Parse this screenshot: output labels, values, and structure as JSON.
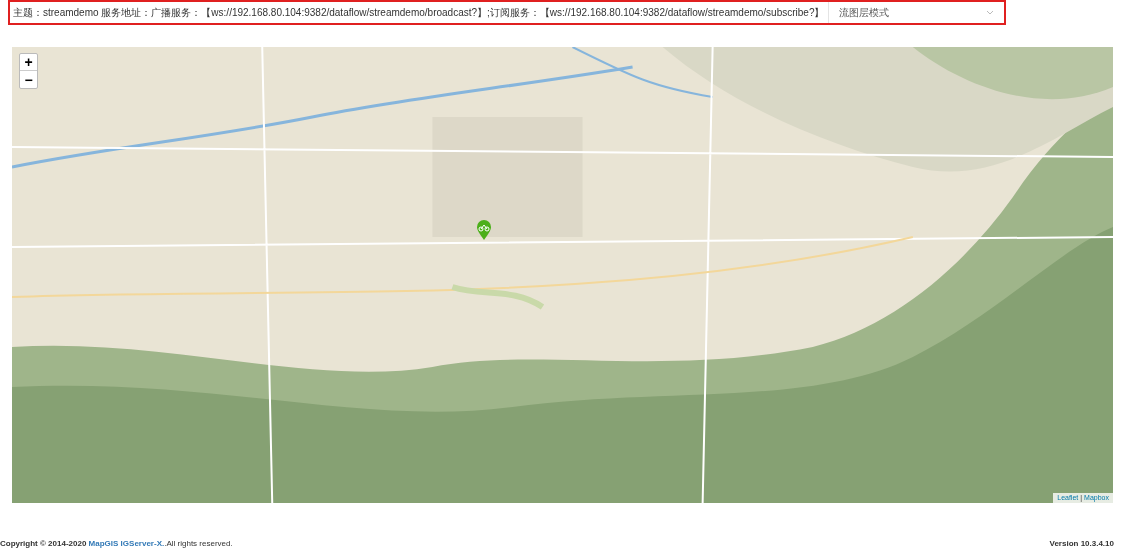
{
  "header": {
    "info": "主题：streamdemo 服务地址：广播服务：【ws://192.168.80.104:9382/dataflow/streamdemo/broadcast?】;订阅服务：【ws://192.168.80.104:9382/dataflow/streamdemo/subscribe?】",
    "mode_select": {
      "value": "流图层模式"
    }
  },
  "map": {
    "zoom_in": "+",
    "zoom_out": "−",
    "attribution": [
      {
        "label": "Leaflet"
      },
      {
        "label": "Mapbox"
      }
    ],
    "separator": "|"
  },
  "footer": {
    "copyright": {
      "prefix": "Copyright © 2014-2020",
      "link": "MapGIS IGServer-X.",
      "suffix": ".All rights reserved."
    },
    "version": "Version 10.3.4.10"
  }
}
